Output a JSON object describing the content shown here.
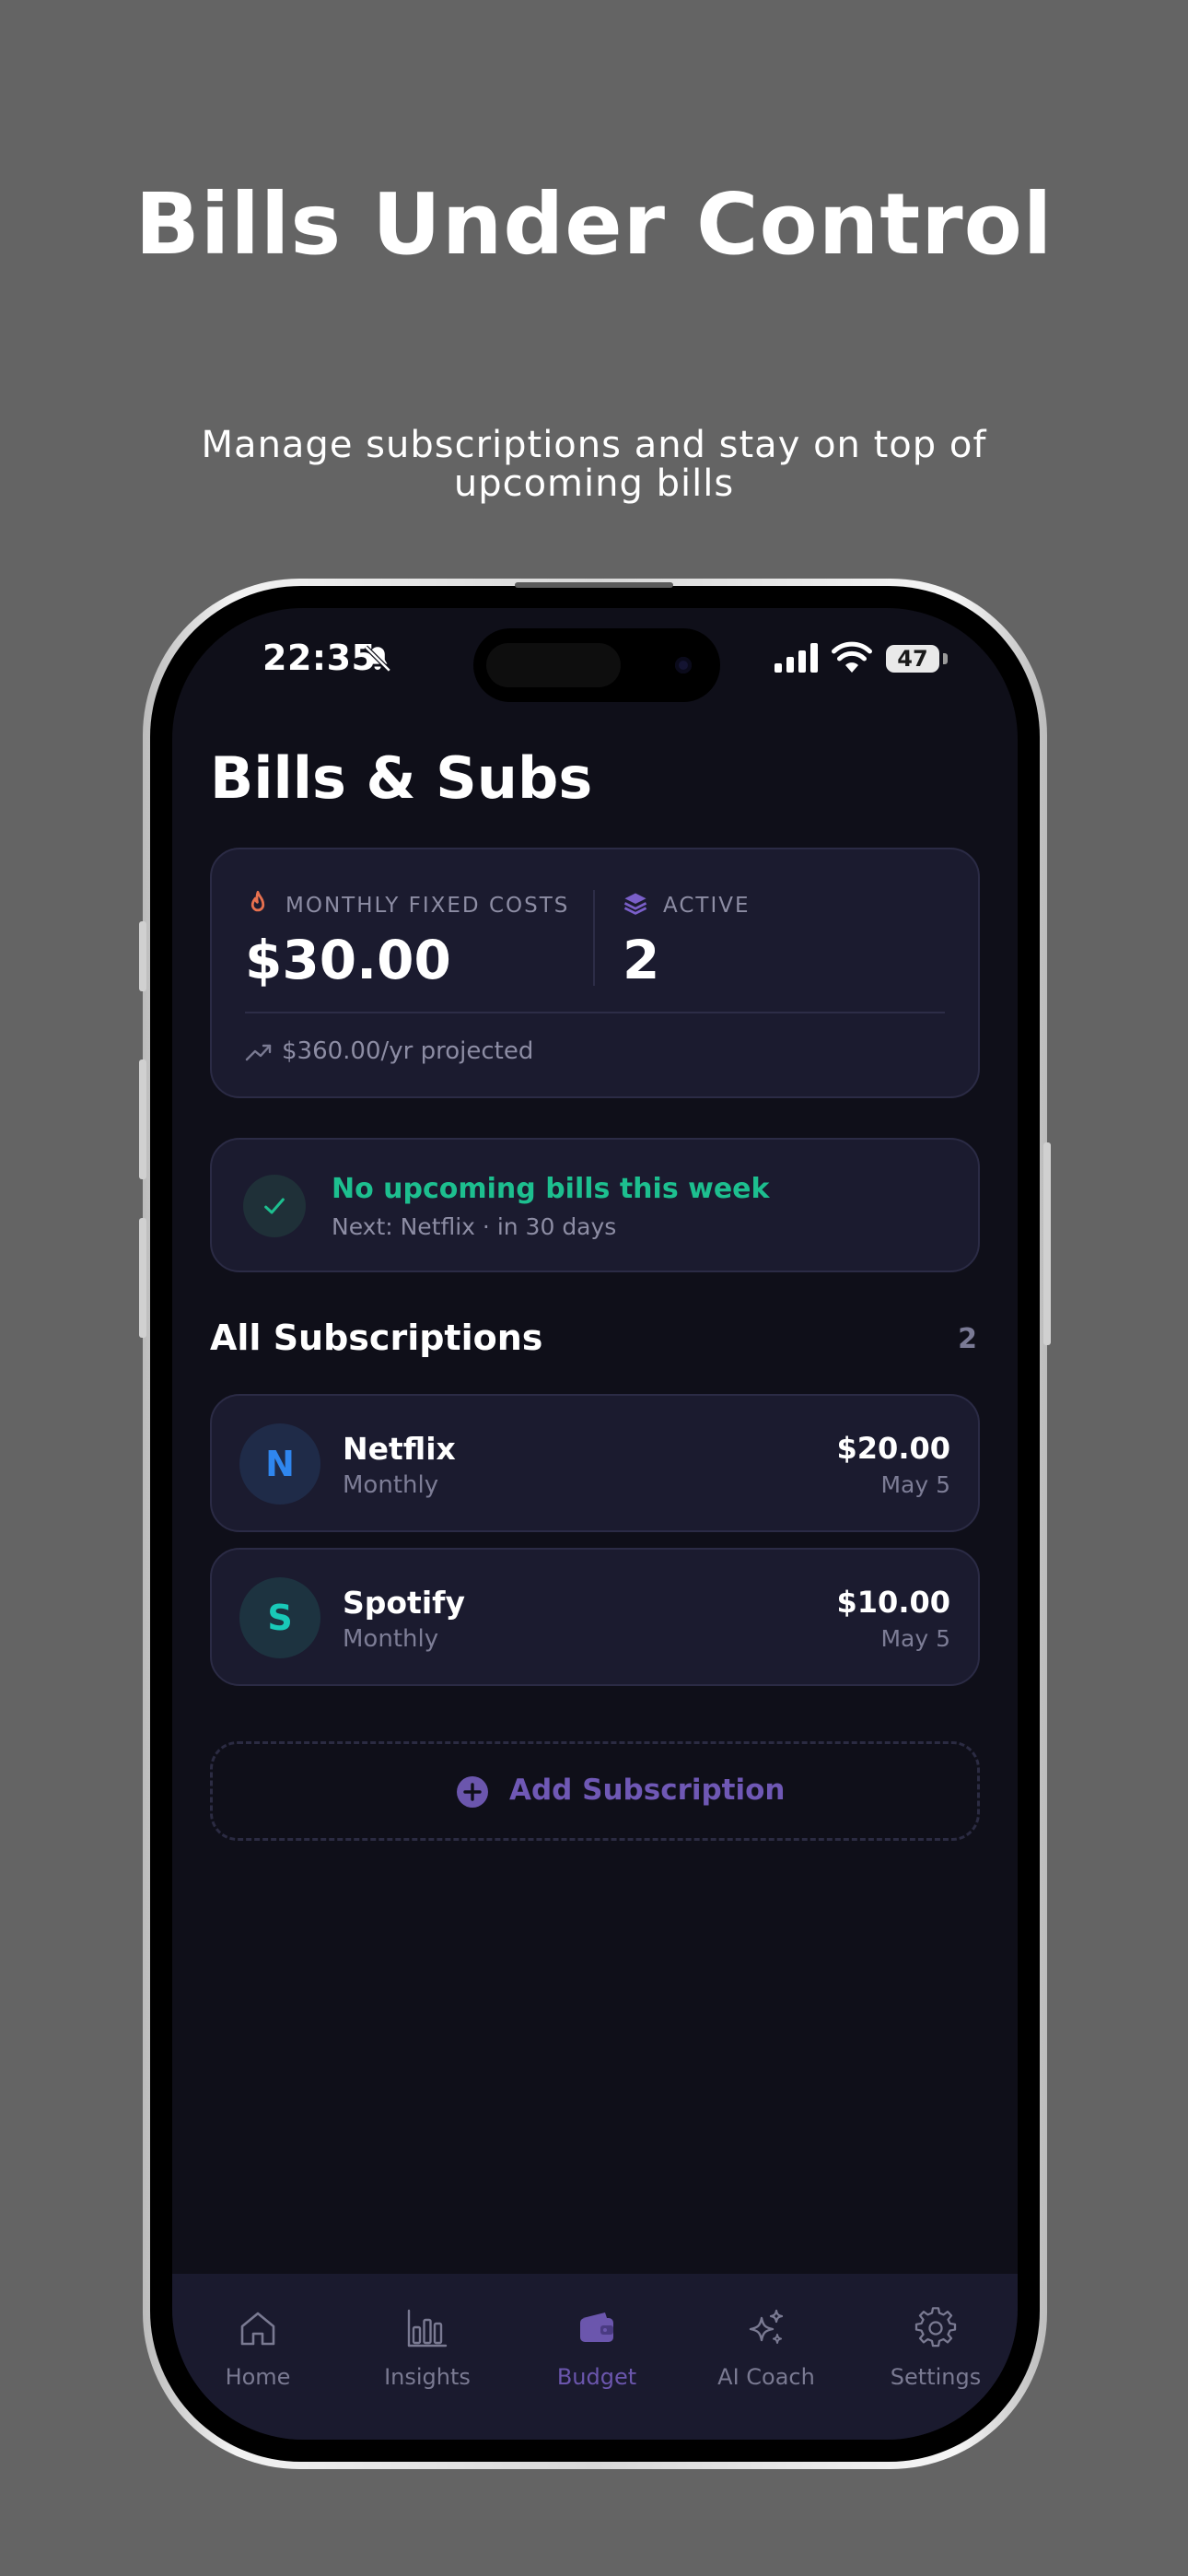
{
  "promo": {
    "title": "Bills Under Control",
    "subtitle": "Manage subscriptions and stay on top of upcoming bills"
  },
  "status_bar": {
    "time": "22:35",
    "battery": "47",
    "icons": [
      "bell-slash-icon",
      "signal-icon",
      "wifi-icon",
      "battery-icon"
    ]
  },
  "page": {
    "title": "Bills & Subs"
  },
  "stats": {
    "fixed_costs_label": "MONTHLY FIXED COSTS",
    "fixed_costs_value": "$30.00",
    "active_label": "ACTIVE",
    "active_value": "2",
    "projected": "$360.00/yr projected",
    "colors": {
      "flame": "#e8714f",
      "layers": "#7a5fc9"
    }
  },
  "upcoming": {
    "title": "No upcoming bills this week",
    "subtitle": "Next: Netflix · in 30 days",
    "color": "#1dbf8f"
  },
  "subscriptions": {
    "section_title": "All Subscriptions",
    "count": "2",
    "items": [
      {
        "initial": "N",
        "name": "Netflix",
        "cycle": "Monthly",
        "amount": "$20.00",
        "date": "May 5"
      },
      {
        "initial": "S",
        "name": "Spotify",
        "cycle": "Monthly",
        "amount": "$10.00",
        "date": "May 5"
      }
    ],
    "add_label": "Add Subscription"
  },
  "tabbar": {
    "tabs": [
      {
        "label": "Home",
        "icon": "home-icon",
        "active": false
      },
      {
        "label": "Insights",
        "icon": "bar-chart-icon",
        "active": false
      },
      {
        "label": "Budget",
        "icon": "wallet-icon",
        "active": true
      },
      {
        "label": "AI Coach",
        "icon": "sparkles-icon",
        "active": false
      },
      {
        "label": "Settings",
        "icon": "gear-icon",
        "active": false
      }
    ],
    "accent": "#6b56ad"
  }
}
